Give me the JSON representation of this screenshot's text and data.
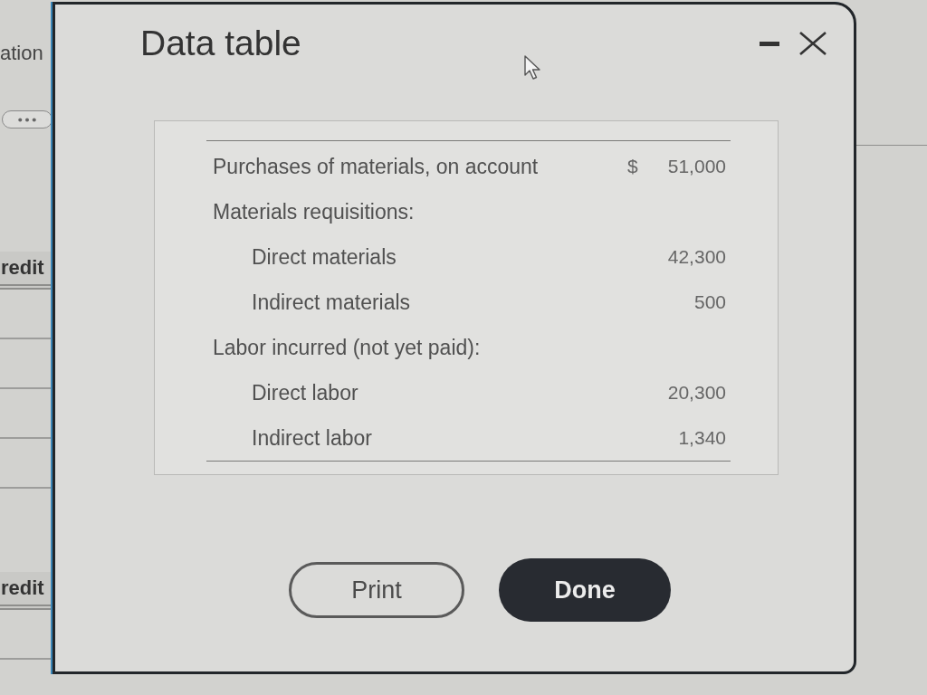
{
  "background": {
    "heading": "ation",
    "column_headers": [
      "redit",
      "redit"
    ]
  },
  "dialog": {
    "title": "Data table",
    "rows": [
      {
        "label": "Purchases of materials, on account",
        "currency": "$",
        "amount": "51,000"
      },
      {
        "label": "Materials requisitions:",
        "children": [
          {
            "label": "Direct materials",
            "amount": "42,300"
          },
          {
            "label": "Indirect materials",
            "amount": "500"
          }
        ]
      },
      {
        "label": "Labor incurred (not yet paid):",
        "children": [
          {
            "label": "Direct labor",
            "amount": "20,300"
          },
          {
            "label": "Indirect labor",
            "amount": "1,340"
          }
        ]
      }
    ],
    "buttons": [
      {
        "label": "Print",
        "kind": "outline"
      },
      {
        "label": "Done",
        "kind": "filled"
      }
    ]
  }
}
